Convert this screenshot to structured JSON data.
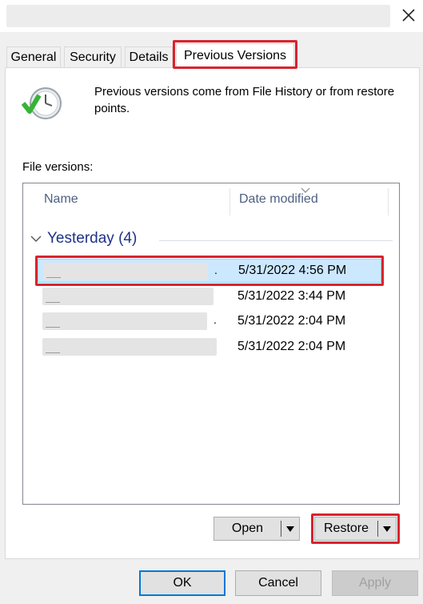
{
  "tabs": [
    {
      "label": "General"
    },
    {
      "label": "Security"
    },
    {
      "label": "Details"
    },
    {
      "label": "Previous Versions"
    }
  ],
  "info": {
    "text": "Previous versions come from File History or from restore points."
  },
  "file_versions": {
    "label": "File versions:",
    "columns": {
      "name": "Name",
      "date_modified": "Date modified"
    },
    "group": {
      "label": "Yesterday (4)"
    },
    "rows": [
      {
        "date": "5/31/2022 4:56 PM"
      },
      {
        "date": "5/31/2022 3:44 PM"
      },
      {
        "date": "5/31/2022 2:04 PM"
      },
      {
        "date": "5/31/2022 2:04 PM"
      }
    ]
  },
  "actions": {
    "open_label": "Open",
    "restore_label": "Restore"
  },
  "dialog": {
    "ok_label": "OK",
    "cancel_label": "Cancel",
    "apply_label": "Apply"
  },
  "colors": {
    "highlight": "#d9232d",
    "selection": "#cce8ff",
    "group_text": "#1e3287",
    "accent": "#0078d7"
  },
  "icons": {
    "title_close": "close-icon",
    "info": "clock-restore-icon",
    "dropdown": "triangle-down-icon"
  }
}
